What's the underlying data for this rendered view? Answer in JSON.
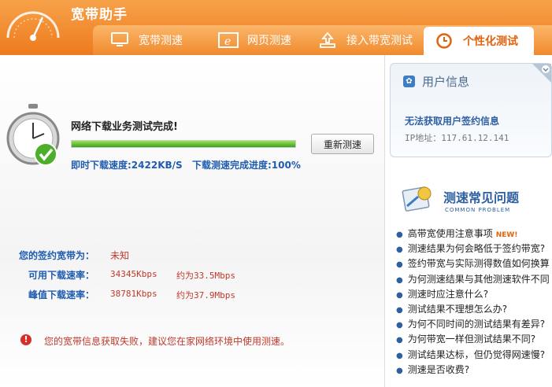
{
  "app": {
    "title": "宽带助手"
  },
  "tabs": [
    {
      "label": "宽带测速",
      "icon": "monitor-icon"
    },
    {
      "label": "网页测速",
      "icon": "browser-icon"
    },
    {
      "label": "接入带宽测试",
      "icon": "upload-icon"
    },
    {
      "label": "个性化测试",
      "icon": "clock-icon",
      "active": true
    }
  ],
  "test": {
    "status": "网络下载业务测试完成!",
    "progress": 1.0,
    "retest_label": "重新测速",
    "instant_speed": "即时下载速度:2422KB/S",
    "completion": "下载测速完成进度:100%"
  },
  "contract": {
    "label": "您的签约宽带为：",
    "value": "未知",
    "rows": [
      {
        "label": "可用下载速率：",
        "kbps": "34345Kbps",
        "mbps": "约为33.5Mbps"
      },
      {
        "label": "峰值下载速率：",
        "kbps": "38781Kbps",
        "mbps": "约为37.9Mbps"
      }
    ]
  },
  "error": {
    "text": "您的宽带信息获取失败，建议您在家网络环境中使用测速。"
  },
  "user": {
    "title": "用户信息",
    "message": "无法获取用户签约信息",
    "ip": "IP地址：117.61.12.141"
  },
  "faq": {
    "title": "测速常见问题",
    "subtitle": "COMMON PROBLEM",
    "items": [
      {
        "text": "高带宽使用注意事项",
        "badge": "NEW!"
      },
      {
        "text": "测速结果为何会略低于签约带宽?"
      },
      {
        "text": "签约带宽与实际测得数值如何换算"
      },
      {
        "text": "为何测速结果与其他测速软件不同"
      },
      {
        "text": "测速时应注意什么?"
      },
      {
        "text": "测试结果不理想怎么办?"
      },
      {
        "text": "为何不同时间的测试结果有差异?"
      },
      {
        "text": "为何带宽一样但测试结果不同?"
      },
      {
        "text": "测试结果达标，但仍觉得网速慢?"
      },
      {
        "text": "测速是否收费?"
      }
    ]
  },
  "colors": {
    "accent": "#ee7a1d",
    "link": "#1f5cb0",
    "error": "#c0392b",
    "progress": "#3aa11c"
  }
}
